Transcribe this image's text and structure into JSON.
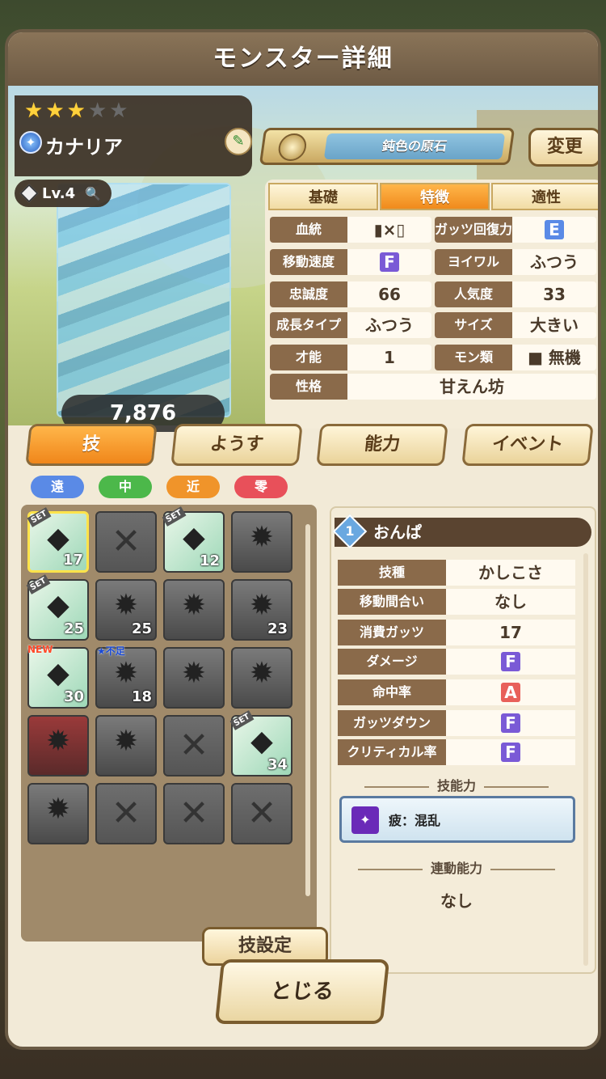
{
  "window_title": "モンスター詳細",
  "monster": {
    "stars": [
      "on",
      "on",
      "on",
      "off",
      "off"
    ],
    "element_icon": "water-element-icon",
    "name": "カナリア",
    "level": "Lv.4",
    "score": "7,876"
  },
  "stone": {
    "label": "鈍色の原石",
    "change_label": "変更"
  },
  "info_tabs": [
    "基礎",
    "特徴",
    "適性"
  ],
  "attributes": {
    "blood": {
      "key": "血統",
      "value": "×"
    },
    "guts_recovery": {
      "key": "ガッツ回復力",
      "value": "E"
    },
    "move_speed": {
      "key": "移動速度",
      "value": "F"
    },
    "yoiwaru": {
      "key": "ヨイワル",
      "value": "ふつう"
    },
    "loyalty": {
      "key": "忠誠度",
      "value": "66"
    },
    "popularity": {
      "key": "人気度",
      "value": "33"
    },
    "growth": {
      "key": "成長タイプ",
      "value": "ふつう"
    },
    "size": {
      "key": "サイズ",
      "value": "大きい"
    },
    "talent": {
      "key": "才能",
      "value": "1"
    },
    "mon_type": {
      "key": "モン類",
      "value": "無機"
    },
    "personality": {
      "key": "性格",
      "value": "甘えん坊"
    }
  },
  "main_tabs": [
    "技",
    "ようす",
    "能力",
    "イベント"
  ],
  "range_pills": [
    "遠",
    "中",
    "近",
    "零"
  ],
  "skills": [
    {
      "kind": "lit",
      "set": "SET",
      "num": "17",
      "sel": true
    },
    {
      "kind": "empty"
    },
    {
      "kind": "lit",
      "set": "SET",
      "num": "12"
    },
    {
      "kind": "dark"
    },
    {
      "kind": "lit",
      "set": "SET",
      "num": "25"
    },
    {
      "kind": "dark",
      "num": "25"
    },
    {
      "kind": "dark"
    },
    {
      "kind": "dark",
      "num": "23"
    },
    {
      "kind": "lit",
      "new": "NEW",
      "num": "30"
    },
    {
      "kind": "dark",
      "lack": "★不足",
      "num": "18"
    },
    {
      "kind": "dark"
    },
    {
      "kind": "dark"
    },
    {
      "kind": "red"
    },
    {
      "kind": "dark"
    },
    {
      "kind": "empty"
    },
    {
      "kind": "lit",
      "set": "SET",
      "num": "34"
    },
    {
      "kind": "dark"
    },
    {
      "kind": "empty"
    },
    {
      "kind": "empty"
    },
    {
      "kind": "empty"
    }
  ],
  "skill_set_button": "技設定",
  "detail": {
    "number": "1",
    "name": "おんぱ",
    "rows": [
      {
        "key": "技種",
        "value": "かしこさ"
      },
      {
        "key": "移動間合い",
        "value": "なし"
      },
      {
        "key": "消費ガッツ",
        "value": "17"
      },
      {
        "key": "ダメージ",
        "value": "F"
      },
      {
        "key": "命中率",
        "value": "A"
      },
      {
        "key": "ガッツダウン",
        "value": "F"
      },
      {
        "key": "クリティカル率",
        "value": "F"
      }
    ],
    "ability_title": "技能力",
    "ability_text": "疲：混乱",
    "link_title": "連動能力",
    "link_value": "なし"
  },
  "close_label": "とじる"
}
